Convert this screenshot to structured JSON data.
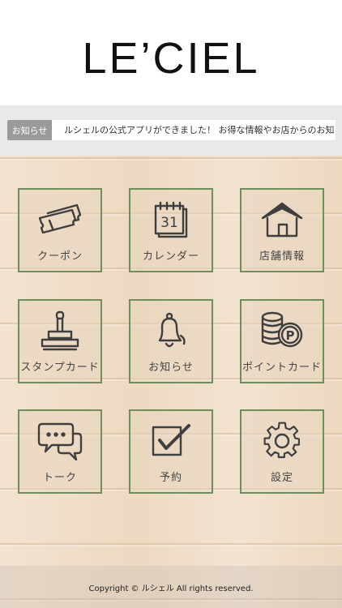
{
  "header": {
    "logo": "LE’CIEL"
  },
  "news": {
    "tag": "お知らせ",
    "text": "ルシェルの公式アプリができました！ お得な情報やお店からのお知らせをお届けします"
  },
  "menu": [
    {
      "label": "クーポン",
      "icon": "ticket-icon"
    },
    {
      "label": "カレンダー",
      "icon": "calendar-icon",
      "icon_text": "31"
    },
    {
      "label": "店舗情報",
      "icon": "house-icon"
    },
    {
      "label": "スタンプカード",
      "icon": "stamp-icon"
    },
    {
      "label": "お知らせ",
      "icon": "bell-icon"
    },
    {
      "label": "ポイントカード",
      "icon": "coins-icon",
      "icon_text": "P"
    },
    {
      "label": "トーク",
      "icon": "chat-icon"
    },
    {
      "label": "予約",
      "icon": "checkbox-icon"
    },
    {
      "label": "設定",
      "icon": "gear-icon"
    }
  ],
  "footer": {
    "copyright": "Copyright © ルシェル All rights reserved."
  },
  "colors": {
    "tile_border": "#6f8f5a",
    "wood": "#efdcc5",
    "news_tag": "#9a9a9a"
  }
}
